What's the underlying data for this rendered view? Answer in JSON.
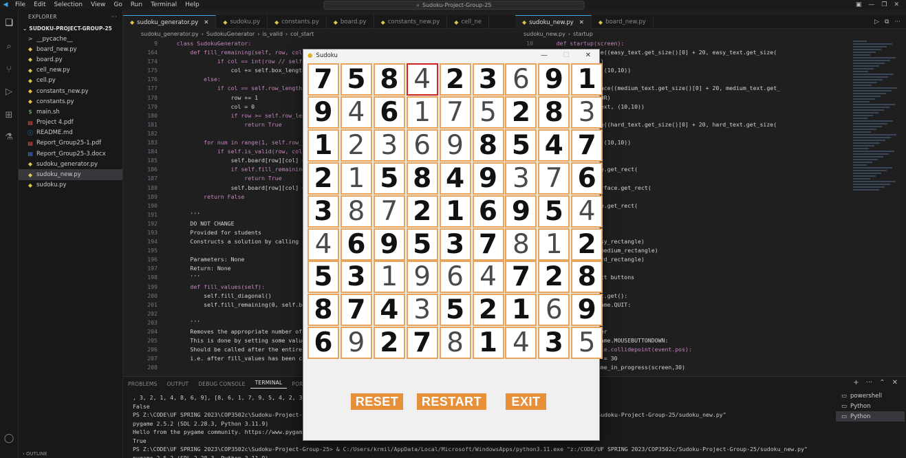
{
  "menu": [
    "File",
    "Edit",
    "Selection",
    "View",
    "Go",
    "Run",
    "Terminal",
    "Help"
  ],
  "search_text": "Sudoku-Project-Group-25",
  "explorer": {
    "title": "EXPLORER",
    "more": "···",
    "project": "SUDOKU-PROJECT-GROUP-25",
    "files": [
      {
        "name": "__pycache__",
        "icon": ">"
      },
      {
        "name": "board_new.py",
        "icon": "py"
      },
      {
        "name": "board.py",
        "icon": "py"
      },
      {
        "name": "cell_new.py",
        "icon": "py"
      },
      {
        "name": "cell.py",
        "icon": "py"
      },
      {
        "name": "constants_new.py",
        "icon": "py"
      },
      {
        "name": "constants.py",
        "icon": "py"
      },
      {
        "name": "main.sh",
        "icon": "$"
      },
      {
        "name": "Project 4.pdf",
        "icon": "pdf"
      },
      {
        "name": "README.md",
        "icon": "i"
      },
      {
        "name": "Report_Group25-1.pdf",
        "icon": "pdf"
      },
      {
        "name": "Report_Group25-3.docx",
        "icon": "w"
      },
      {
        "name": "sudoku_generator.py",
        "icon": "py"
      },
      {
        "name": "sudoku_new.py",
        "icon": "py"
      },
      {
        "name": "sudoku.py",
        "icon": "py"
      }
    ]
  },
  "tabs_left": [
    "sudoku_generator.py",
    "sudoku.py",
    "constants.py",
    "board.py",
    "constants_new.py",
    "cell_ne"
  ],
  "tabs_right": [
    "sudoku_new.py",
    "board_new.py"
  ],
  "breadcrumb_left": [
    "sudoku_generator.py",
    "SudokuGenerator",
    "is_valid",
    "col_start"
  ],
  "breadcrumb_right": [
    "sudoku_new.py",
    "startup"
  ],
  "left_code": {
    "line_numbers": [
      "9",
      "164",
      "174",
      "175",
      "176",
      "177",
      "178",
      "179",
      "180",
      "181",
      "182",
      "183",
      "184",
      "185",
      "186",
      "187",
      "188",
      "189",
      "190",
      "191",
      "192",
      "193",
      "194",
      "195",
      "196",
      "197",
      "198",
      "199",
      "200",
      "201",
      "202",
      "203",
      "204",
      "205",
      "206",
      "207",
      "208"
    ],
    "lines": [
      "    class SudokuGenerator:",
      "        def fill_remaining(self, row, col):",
      "                if col == int(row // self.bo",
      "                    col += self.box_length",
      "            else:",
      "                if col == self.row_length -",
      "                    row += 1",
      "                    col = 0",
      "                    if row >= self.row_lengt",
      "                        return True",
      "",
      "            for num in range(1, self.row_len",
      "                if self.is_valid(row, col, n",
      "                    self.board[row][col] = n",
      "                    if self.fill_remaining(r",
      "                        return True",
      "                    self.board[row][col] = 0",
      "            return False",
      "",
      "        '''",
      "        DO NOT CHANGE",
      "        Provided for students",
      "        Constructs a solution by calling fil",
      "",
      "        Parameters: None",
      "        Return: None",
      "        '''",
      "        def fill_values(self):",
      "            self.fill_diagonal()",
      "            self.fill_remaining(0, self.box_",
      "",
      "        '''",
      "        Removes the appropriate number of ce",
      "        This is done by setting some values",
      "        Should be called after the entire so",
      "        i.e. after fill_values has been call",
      ""
    ]
  },
  "right_code": {
    "line_numbers": [
      "10"
    ],
    "lines": [
      "    def startup(screen):",
      "e = pygame.Surface((easy_text.get_size()[0] + 20, easy_text.get_size(",
      "e.fill(LINE_COLOR)",
      "e.blit(easy_text, (10,10))",
      "",
      "ace = pygame.Surface((medium_text.get_size()[0] + 20, medium_text.get_",
      "ace.fill(LINE_COLOR)",
      "ace.blit(medium_text, (10,10))",
      "",
      "e = pygame.Surface((hard_text.get_size()[0] + 20, hard_text.get_size(",
      "e.fill(LINE_COLOR)",
      "e.blit(hard_text, (10,10))",
      "",
      "button rectangle",
      "gle = hard_surface.get_rect(",
      "(WIDTH // 2, 660))",
      "angle = medium_surface.get_rect(",
      "(WIDTH // 2, 440))",
      "gle = easy_surface.get_rect(",
      "(WIDTH//2 , 220))",
      "",
      "ns",
      "(easy_surface, easy_rectangle)",
      "(medium_surface, medium_rectangle)",
      "(hard_surface, hard_rectangle)",
      "",
      "game loop to select buttons",
      "",
      "nt in pygame.event.get():",
      "event.type == pygame.QUIT:",
      "  sys.exit()",
      "",
      "ouse button handler",
      "event.type == pygame.MOUSEBUTTONDOWN:",
      "  if easy_rectangle.collidepoint(event.pos):",
      "      #difficulty = 30",
      "      winner = game_in_progress(screen,30)"
    ]
  },
  "panel": {
    "tabs": [
      "PROBLEMS",
      "OUTPUT",
      "DEBUG CONSOLE",
      "TERMINAL",
      "PORTS"
    ],
    "active": "TERMINAL",
    "terminal": [
      ", 3, 2, 1, 4, 8, 6, 9], [8, 6, 1, 7, 9, 5, 4, 2, 3]]",
      "False",
      "PS Z:\\CODE\\UF SPRING 2023\\COP3502c\\Sudoku-Project-G                                                                 SPRING 2023/COP3502c/Sudoku-Project-Group-25/sudoku_new.py\"",
      "pygame 2.5.2 (SDL 2.28.3, Python 3.11.9)",
      "Hello from the pygame community. https://www.pygame",
      "True",
      "PS Z:\\CODE\\UF SPRING 2023\\COP3502c\\Sudoku-Project-Group-25> & C:/Users/krmil/AppData/Local/Microsoft/WindowsApps/python3.11.exe \"z:/CODE/UF SPRING 2023/COP3502c/Sudoku-Project-Group-25/sudoku_new.py\"",
      "pygame 2.5.2 (SDL 2.28.3, Python 3.11.9)"
    ],
    "shells": [
      "powershell",
      "Python",
      "Python"
    ]
  },
  "outline_label": "OUTLINE",
  "sudoku_window": {
    "title": "Sudoku",
    "grid": [
      [
        7,
        5,
        8,
        4,
        2,
        3,
        6,
        9,
        1
      ],
      [
        9,
        4,
        6,
        1,
        7,
        5,
        2,
        8,
        3
      ],
      [
        1,
        2,
        3,
        6,
        9,
        8,
        5,
        4,
        7
      ],
      [
        2,
        1,
        5,
        8,
        4,
        9,
        3,
        7,
        6
      ],
      [
        3,
        8,
        7,
        2,
        1,
        6,
        9,
        5,
        4
      ],
      [
        4,
        6,
        9,
        5,
        3,
        7,
        8,
        1,
        2
      ],
      [
        5,
        3,
        1,
        9,
        6,
        4,
        7,
        2,
        8
      ],
      [
        8,
        7,
        4,
        3,
        5,
        2,
        1,
        6,
        9
      ],
      [
        6,
        9,
        2,
        7,
        8,
        1,
        4,
        3,
        5
      ]
    ],
    "hint_mask": [
      [
        0,
        0,
        0,
        1,
        0,
        0,
        1,
        0,
        0
      ],
      [
        0,
        1,
        0,
        1,
        1,
        1,
        0,
        0,
        1
      ],
      [
        0,
        1,
        1,
        1,
        1,
        0,
        0,
        0,
        0
      ],
      [
        0,
        1,
        0,
        0,
        0,
        0,
        1,
        1,
        0
      ],
      [
        0,
        1,
        1,
        0,
        0,
        0,
        0,
        0,
        1
      ],
      [
        1,
        0,
        0,
        0,
        0,
        0,
        1,
        1,
        0
      ],
      [
        0,
        0,
        1,
        1,
        1,
        1,
        0,
        0,
        0
      ],
      [
        0,
        0,
        0,
        1,
        0,
        0,
        0,
        1,
        0
      ],
      [
        0,
        1,
        0,
        0,
        1,
        0,
        1,
        0,
        1
      ]
    ],
    "selected": [
      0,
      3
    ],
    "buttons": {
      "reset": "RESET",
      "restart": "RESTART",
      "exit": "EXIT"
    }
  }
}
